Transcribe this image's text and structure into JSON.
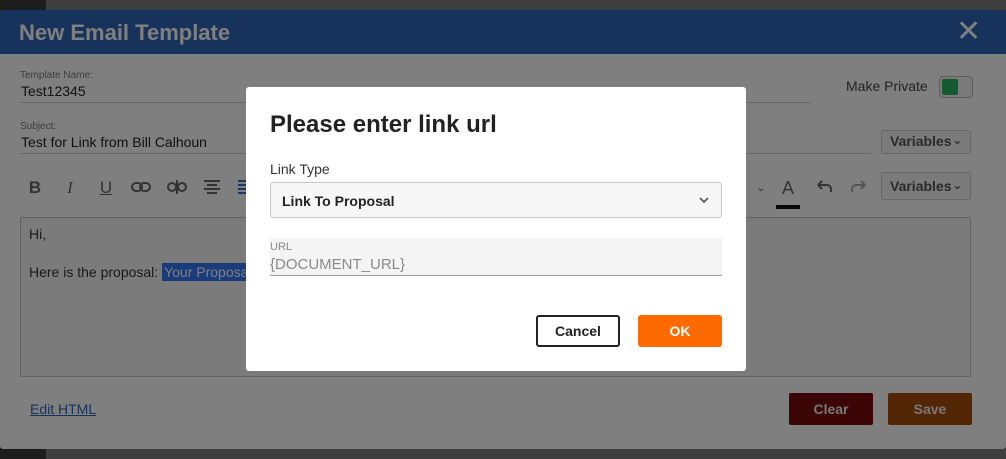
{
  "main": {
    "title": "New Email Template",
    "close_icon": "close-icon",
    "template_name_label": "Template Name:",
    "template_name_value": "Test12345",
    "make_private_label": "Make Private",
    "subject_label": "Subject:",
    "subject_value": "Test for Link from Bill Calhoun",
    "variables_label": "Variables",
    "toolbar_icons": [
      "bold-icon",
      "italic-icon",
      "underline-icon",
      "link-icon",
      "unlink-icon",
      "align-center-icon",
      "align-justify-icon",
      "font-color-icon",
      "undo-icon",
      "redo-icon"
    ],
    "editor": {
      "line1": "Hi,",
      "line2_prefix": "Here is the proposal: ",
      "line2_link": "Your Proposa"
    },
    "edit_html_label": "Edit HTML",
    "clear_label": "Clear",
    "save_label": "Save"
  },
  "dialog": {
    "title": "Please enter link url",
    "link_type_label": "Link Type",
    "link_type_value": "Link To Proposal",
    "url_label": "URL",
    "url_value": "{DOCUMENT_URL}",
    "cancel_label": "Cancel",
    "ok_label": "OK"
  },
  "colors": {
    "header": "#2e66b8",
    "ok_button": "#ff6a00",
    "toggle_on": "#28b463",
    "clear_button": "#7a0c0c",
    "save_button": "#a64f0d"
  }
}
